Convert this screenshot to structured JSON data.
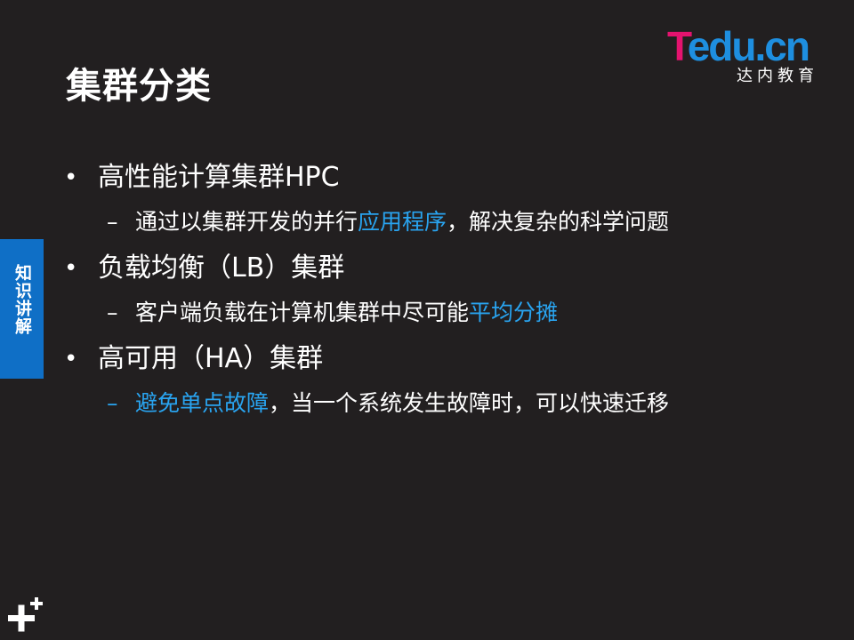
{
  "slide": {
    "title": "集群分类",
    "side_tab": "知识讲解",
    "logo": {
      "brand_t": "T",
      "brand_rest": "edu.cn",
      "subtitle": "达内教育"
    },
    "bullets": [
      {
        "text": "高性能计算集群HPC",
        "sub": {
          "pre": "通过以集群开发的并行",
          "highlight": "应用程序",
          "post": "，解决复杂的科学问题"
        }
      },
      {
        "text": "负载均衡（LB）集群",
        "sub": {
          "pre": "客户端负载在计算机集群中尽可能",
          "highlight": "平均分摊",
          "post": ""
        }
      },
      {
        "text": "高可用（HA）集群",
        "sub": {
          "pre": "",
          "highlight": "避免单点故障",
          "post": "，当一个系统发生故障时，可以快速迁移"
        }
      }
    ],
    "bullet_glyph": "•",
    "dash_glyph": "–"
  },
  "colors": {
    "background": "#221f20",
    "highlight": "#29a4f0",
    "side_tab": "#0f6fc6",
    "logo_t": "#e4136f",
    "logo_blue": "#1e8fe0"
  },
  "icons": {
    "corner": "plus-decoration-icon"
  }
}
